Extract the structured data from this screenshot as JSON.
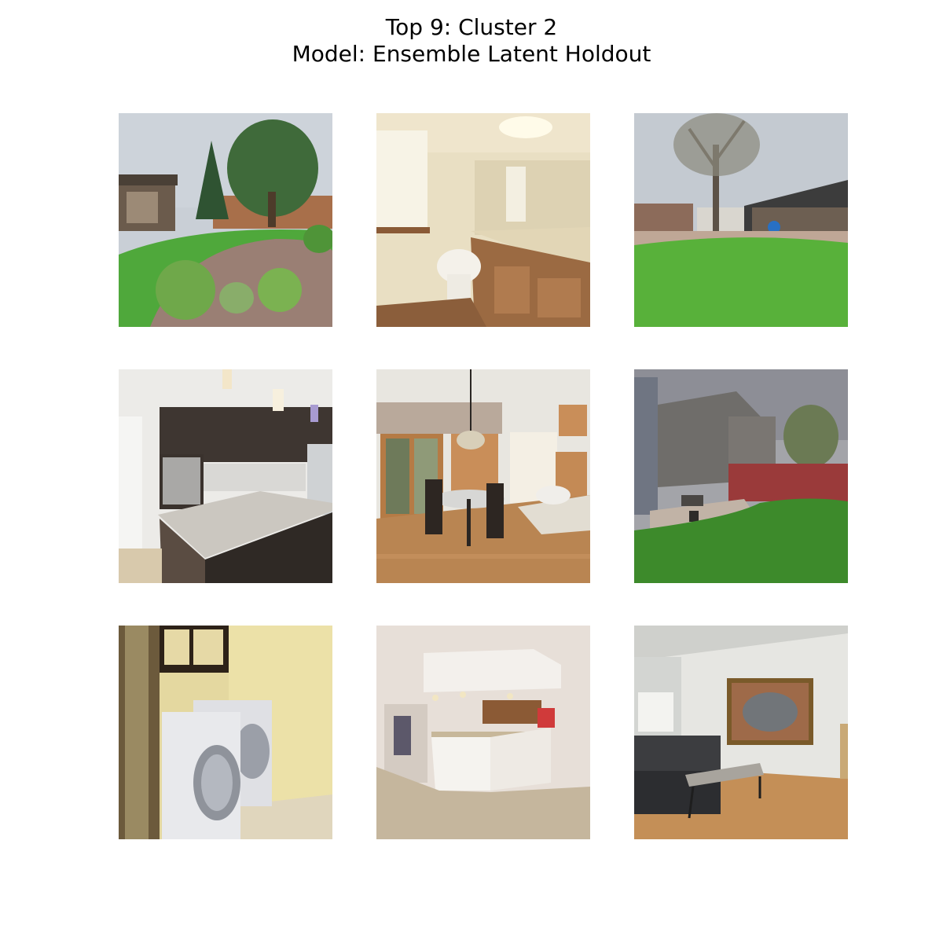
{
  "figure": {
    "title_line1": "Top 9: Cluster 2",
    "title_line2": "Model: Ensemble Latent Holdout"
  },
  "images": [
    {
      "depicts": "backyard-lawn-trees"
    },
    {
      "depicts": "bathroom-vanity-toilet"
    },
    {
      "depicts": "backyard-lawn-bare-tree"
    },
    {
      "depicts": "kitchen-island-dark-cabinets"
    },
    {
      "depicts": "dining-room-round-table"
    },
    {
      "depicts": "backyard-patio-red-fence"
    },
    {
      "depicts": "laundry-room-washer-dryer"
    },
    {
      "depicts": "empty-room-kitchen-bar"
    },
    {
      "depicts": "living-room-leather-sofa"
    }
  ]
}
